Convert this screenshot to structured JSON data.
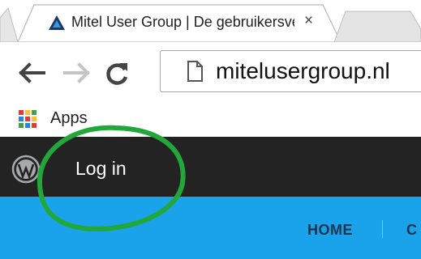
{
  "browser": {
    "tab": {
      "title": "Mitel User Group | De gebruikersvereniging",
      "close_glyph": "×",
      "favicon": "mitel-triangle-icon"
    },
    "toolbar": {
      "back": "back-arrow-icon",
      "forward": "forward-arrow-icon",
      "reload": "reload-icon",
      "url": "mitelusergroup.nl",
      "page_icon": "page-icon"
    },
    "bookmarks": {
      "apps_label": "Apps",
      "apps_icon": "apps-grid-icon"
    }
  },
  "adminbar": {
    "logo": "wordpress-icon",
    "login_label": "Log in"
  },
  "site_nav": {
    "items": [
      "HOME",
      "C"
    ]
  },
  "annotation": {
    "shape": "green-ellipse",
    "color": "#22a83a"
  },
  "colors": {
    "adminbar_bg": "#232323",
    "header_bg": "#1aa3ea",
    "nav_text": "#1a3550"
  }
}
